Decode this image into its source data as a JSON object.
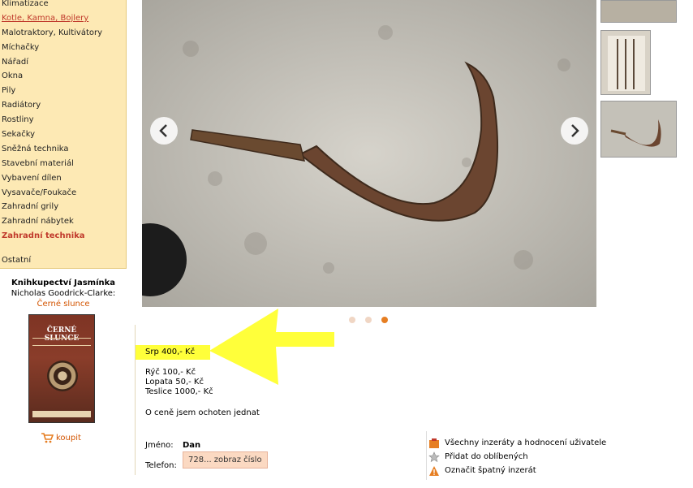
{
  "sidebar": {
    "categories": [
      {
        "label": "Klimatizace",
        "style": ""
      },
      {
        "label": "Kotle, Kamna, Bojlery",
        "style": "link"
      },
      {
        "label": "Malotraktory, Kultivátory",
        "style": ""
      },
      {
        "label": "Míchačky",
        "style": ""
      },
      {
        "label": "Nářadí",
        "style": ""
      },
      {
        "label": "Okna",
        "style": ""
      },
      {
        "label": "Pily",
        "style": ""
      },
      {
        "label": "Radiátory",
        "style": ""
      },
      {
        "label": "Rostliny",
        "style": ""
      },
      {
        "label": "Sekačky",
        "style": ""
      },
      {
        "label": "Sněžná technika",
        "style": ""
      },
      {
        "label": "Stavební materiál",
        "style": ""
      },
      {
        "label": "Vybavení dílen",
        "style": ""
      },
      {
        "label": "Vysavače/Foukače",
        "style": ""
      },
      {
        "label": "Zahradní grily",
        "style": ""
      },
      {
        "label": "Zahradní nábytek",
        "style": ""
      },
      {
        "label": "Zahradní technika",
        "style": "active"
      },
      {
        "label": "Ostatní",
        "style": "gap"
      }
    ]
  },
  "promo": {
    "shop": "Knihkupectví Jasmínka",
    "author": "Nicholas Goodrick-Clarke:",
    "book_title": "Černé slunce",
    "cover_title": "ČERNÉ SLUNCE",
    "buy_label": "koupit"
  },
  "gallery": {
    "slide_count": 3,
    "active_slide": 3
  },
  "listing": {
    "headline_price": "Srp 400,- Kč",
    "prices": [
      "Rýč 100,- Kč",
      "Lopata 50,- Kč",
      "Teslice 1000,- Kč"
    ],
    "note": "O ceně jsem ochoten jednat"
  },
  "contact": {
    "name_label": "Jméno:",
    "name_value": "Dan",
    "phone_label": "Telefon:",
    "phone_button": "728... zobraz číslo"
  },
  "actions": {
    "all_ads": "Všechny inzeráty a hodnocení uživatele",
    "favorite": "Přidat do oblíbených",
    "report": "Označit špatný inzerát"
  },
  "colors": {
    "sidebar_bg": "#fde9b4",
    "accent": "#e67e22",
    "highlight": "#ffff3a"
  }
}
